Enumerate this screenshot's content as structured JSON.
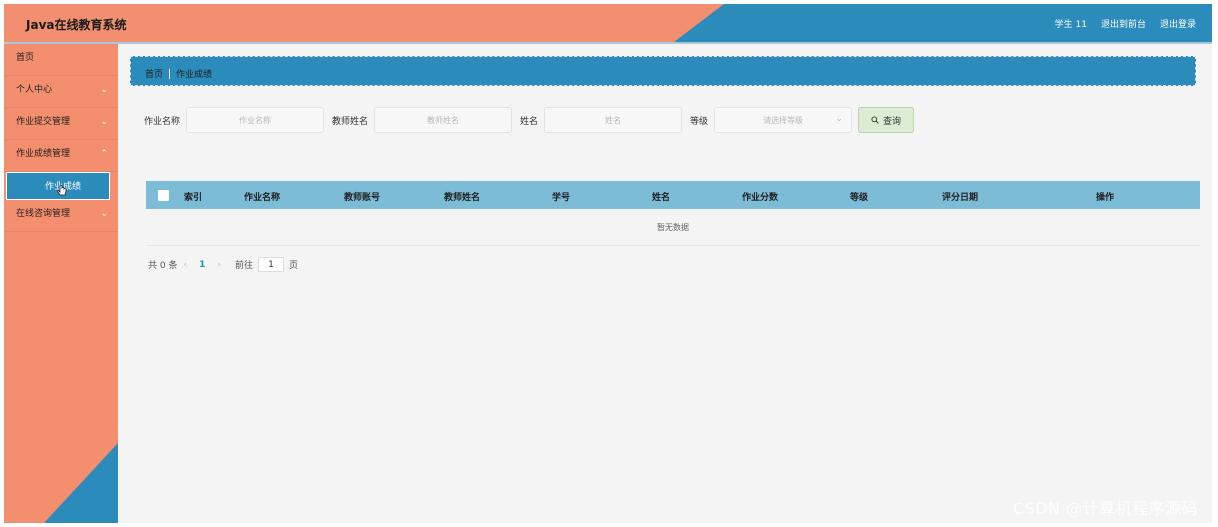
{
  "header": {
    "app_title": "Java在线教育系统",
    "user_label": "学生 11",
    "back_to_front": "退出到前台",
    "logout": "退出登录"
  },
  "sidebar": {
    "items": [
      {
        "label": "首页"
      },
      {
        "label": "个人中心"
      },
      {
        "label": "作业提交管理"
      },
      {
        "label": "作业成绩管理"
      },
      {
        "label": "在线咨询管理"
      }
    ],
    "submenu": {
      "label": "作业成绩"
    }
  },
  "breadcrumb": {
    "home": "首页",
    "current": "作业成绩"
  },
  "search": {
    "fields": [
      {
        "label": "作业名称",
        "placeholder": "作业名称"
      },
      {
        "label": "教师姓名",
        "placeholder": "教师姓名"
      },
      {
        "label": "姓名",
        "placeholder": "姓名"
      }
    ],
    "grade": {
      "label": "等级",
      "placeholder": "请选择等级"
    },
    "query_button": "查询"
  },
  "table": {
    "columns": [
      "索引",
      "作业名称",
      "教师账号",
      "教师姓名",
      "学号",
      "姓名",
      "作业分数",
      "等级",
      "评分日期",
      "操作"
    ],
    "empty_text": "暂无数据"
  },
  "pager": {
    "total": "共 0 条",
    "current_page": "1",
    "goto_label": "前往",
    "goto_value": "1",
    "page_unit": "页"
  },
  "watermark": "CSDN @计算机程序源码",
  "colors": {
    "accent_blue": "#2b8bbb",
    "salmon": "#f38e6f",
    "table_header": "#7cbcd7"
  }
}
